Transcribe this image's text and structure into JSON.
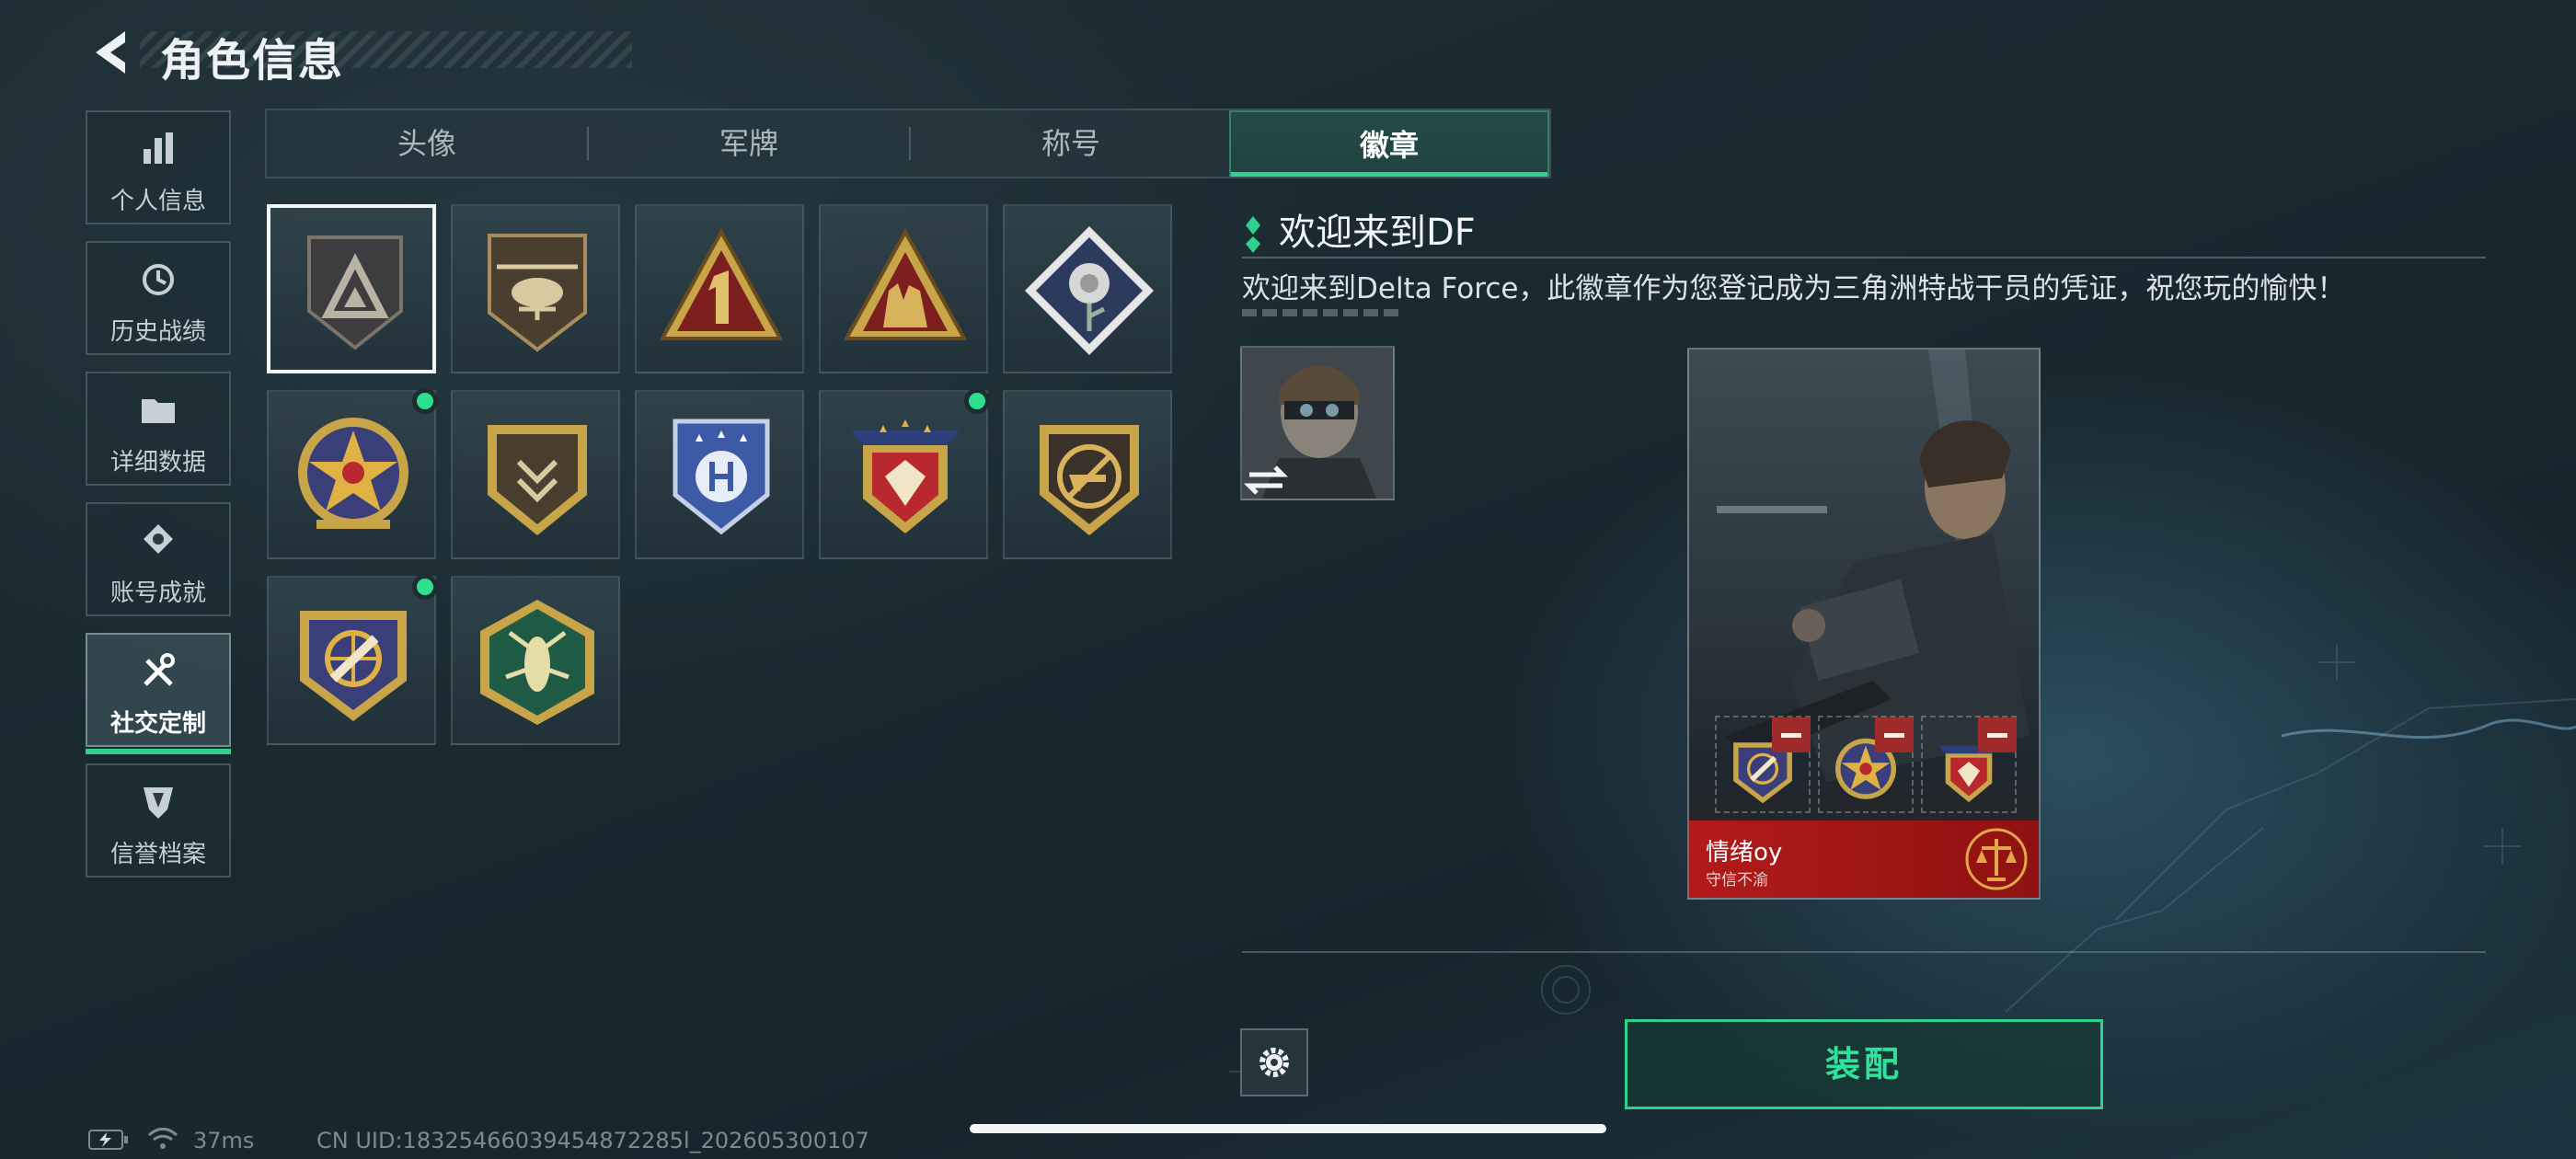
{
  "header": {
    "title": "角色信息"
  },
  "side_nav": {
    "items": [
      {
        "id": "personal",
        "label": "个人信息",
        "icon": "bar-chart-icon"
      },
      {
        "id": "history",
        "label": "历史战绩",
        "icon": "history-icon"
      },
      {
        "id": "details",
        "label": "详细数据",
        "icon": "folder-icon"
      },
      {
        "id": "achievements",
        "label": "账号成就",
        "icon": "medal-icon"
      },
      {
        "id": "social",
        "label": "社交定制",
        "icon": "tools-icon",
        "active": true
      },
      {
        "id": "reputation",
        "label": "信誉档案",
        "icon": "shield-icon"
      }
    ]
  },
  "tabs": [
    {
      "label": "头像"
    },
    {
      "label": "军牌"
    },
    {
      "label": "称号"
    },
    {
      "label": "徽章",
      "active": true
    }
  ],
  "badges": [
    {
      "name": "delta-triangle-badge",
      "selected": true,
      "new": false
    },
    {
      "name": "helicopter-badge",
      "selected": false,
      "new": false
    },
    {
      "name": "number-one-badge",
      "selected": false,
      "new": false
    },
    {
      "name": "soldiers-badge",
      "selected": false,
      "new": false
    },
    {
      "name": "rose-badge",
      "selected": false,
      "new": false
    },
    {
      "name": "star-target-badge",
      "selected": false,
      "new": true
    },
    {
      "name": "chevron-shield-badge",
      "selected": false,
      "new": false
    },
    {
      "name": "blue-stars-shield-badge",
      "selected": false,
      "new": false
    },
    {
      "name": "gem-shield-badge",
      "selected": false,
      "new": true
    },
    {
      "name": "rifle-prohibited-badge",
      "selected": false,
      "new": false
    },
    {
      "name": "crosshair-bullet-badge",
      "selected": false,
      "new": true
    },
    {
      "name": "wasp-badge",
      "selected": false,
      "new": false
    }
  ],
  "detail": {
    "title": "欢迎来到DF",
    "description": "欢迎来到Delta Force，此徽章作为您登记成为三角洲特战干员的凭证，祝您玩的愉快！"
  },
  "card": {
    "name": "情绪oy",
    "subtitle": "守信不渝",
    "emblem": "scales-of-justice-icon"
  },
  "actions": {
    "equip_label": "装配",
    "settings_icon": "gear-icon"
  },
  "status": {
    "ping": "37ms",
    "uid": "CN UID:18325466039454872285l_202605300107"
  },
  "colors": {
    "accent": "#2fd18f",
    "card_footer": "#b21a1a",
    "new_dot": "#2ee08e"
  }
}
